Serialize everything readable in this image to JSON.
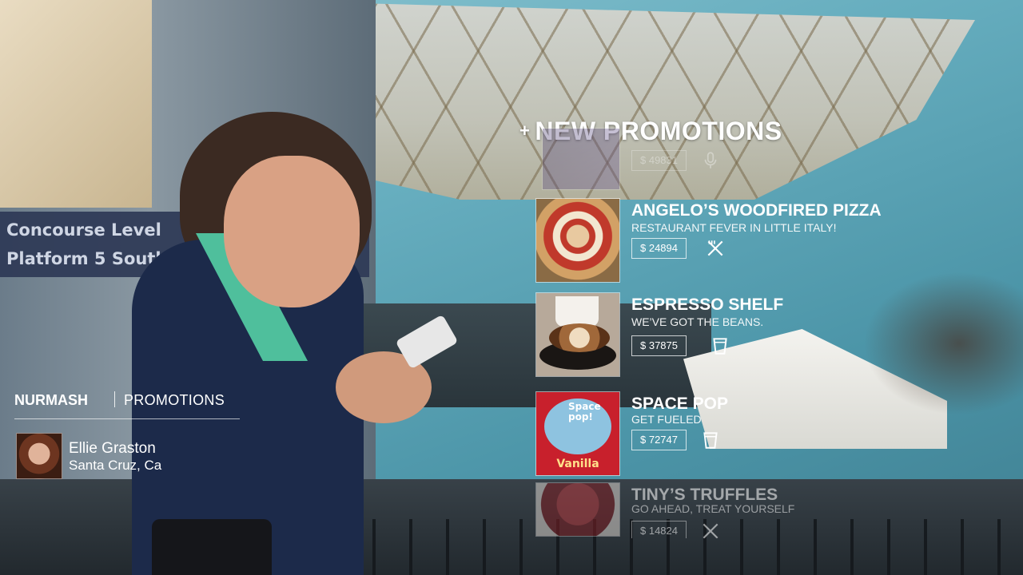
{
  "background": {
    "sign_line1": "Concourse Level",
    "sign_line2": "Platform 5 Southbo"
  },
  "promotions": {
    "plus": "+",
    "title": "NEW PROMOTIONS",
    "top_partial": {
      "price": "$ 49831",
      "icon": "microphone-icon"
    },
    "items": [
      {
        "name": "ANGELO’S WOODFIRED PIZZA",
        "tagline": "RESTAURANT FEVER IN LITTLE ITALY!",
        "price": "$ 24894",
        "icon": "fork-knife-icon"
      },
      {
        "name": "ESPRESSO SHELF",
        "tagline": "WE’VE GOT THE BEANS.",
        "price": "$ 37875",
        "icon": "cup-icon"
      },
      {
        "name": "SPACE POP",
        "tagline": "GET FUELED",
        "price": "$ 72747",
        "icon": "cup-icon",
        "image_text": "Vanilla",
        "image_title": "Space pop!"
      },
      {
        "name": "TINY’S TRUFFLES",
        "tagline": "GO AHEAD, TREAT YOURSELF",
        "price": "$ 14824",
        "icon": "fork-knife-icon"
      }
    ]
  },
  "branding": {
    "brand": "NURMASH",
    "section": "PROMOTIONS"
  },
  "user": {
    "name": "Ellie Graston",
    "location": "Santa Cruz, Ca"
  }
}
